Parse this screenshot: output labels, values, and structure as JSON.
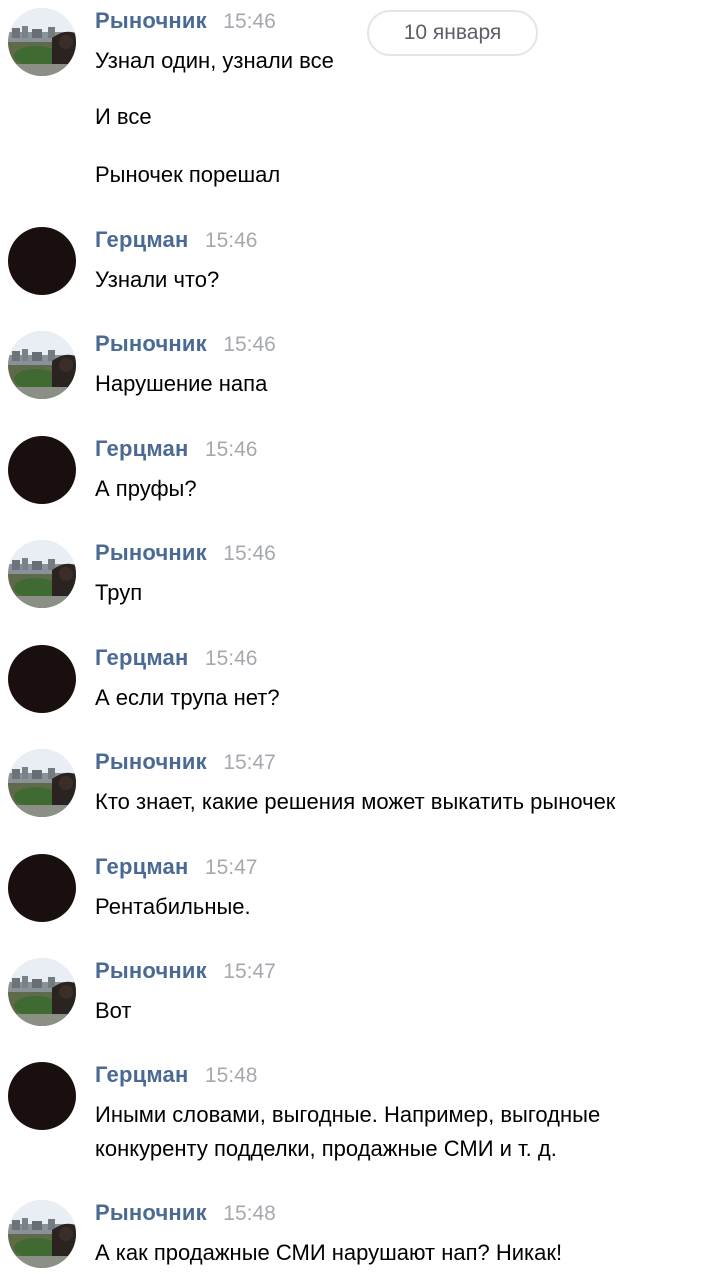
{
  "date_divider": "10 января",
  "messages": [
    {
      "author": "Рыночник",
      "time": "15:46",
      "lines": [
        "Узнал один, узнали все",
        "И все",
        "Рыночек порешал"
      ]
    },
    {
      "author": "Герцман",
      "time": "15:46",
      "lines": [
        "Узнали что?"
      ]
    },
    {
      "author": "Рыночник",
      "time": "15:46",
      "lines": [
        "Нарушение напа"
      ]
    },
    {
      "author": "Герцман",
      "time": "15:46",
      "lines": [
        "А пруфы?"
      ]
    },
    {
      "author": "Рыночник",
      "time": "15:46",
      "lines": [
        "Труп"
      ]
    },
    {
      "author": "Герцман",
      "time": "15:46",
      "lines": [
        "А если трупа нет?"
      ]
    },
    {
      "author": "Рыночник",
      "time": "15:47",
      "lines": [
        "Кто знает, какие решения может выкатить рыночек"
      ]
    },
    {
      "author": "Герцман",
      "time": "15:47",
      "lines": [
        "Рентабильные."
      ]
    },
    {
      "author": "Рыночник",
      "time": "15:47",
      "lines": [
        "Вот"
      ]
    },
    {
      "author": "Герцман",
      "time": "15:48",
      "lines": [
        "Иными словами, выгодные. Например, выгодные",
        "конкуренту подделки, продажные СМИ и т. д."
      ]
    },
    {
      "author": "Рыночник",
      "time": "15:48",
      "lines": [
        "А как продажные СМИ нарушают нап? Никак!"
      ]
    }
  ],
  "colors": {
    "author_name": "#4a6a94",
    "timestamp": "#a5a9ae",
    "avatar_dark": "#1a0f0f"
  }
}
